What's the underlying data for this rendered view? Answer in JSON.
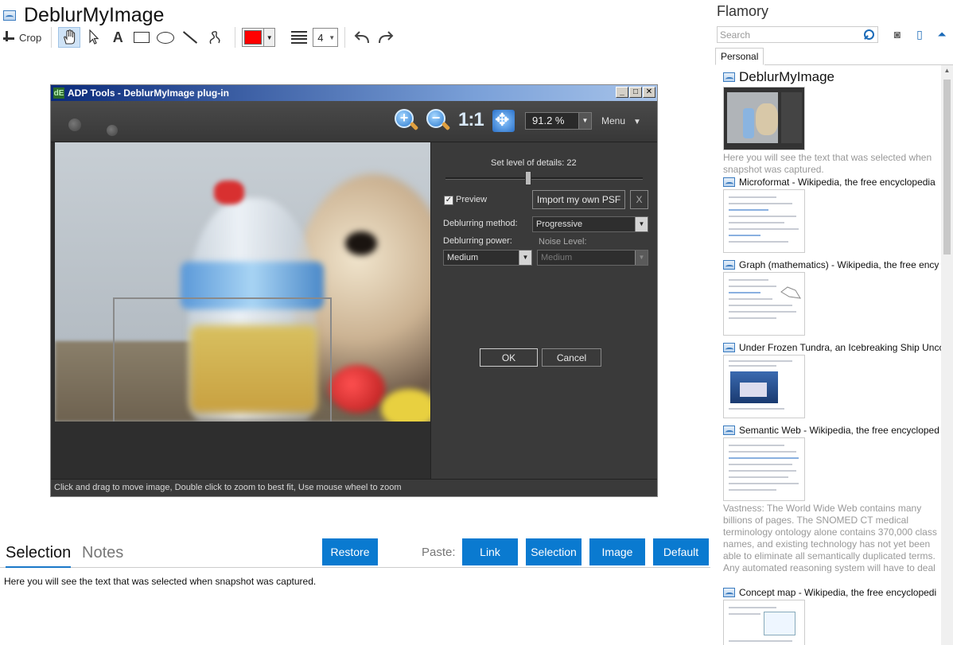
{
  "app": {
    "title": "DeblurMyImage"
  },
  "toolbar": {
    "crop_label": "Crop",
    "text_tool": "A",
    "line_width": "4",
    "color": "#ff0000",
    "tools": [
      "hand-icon",
      "arrow-icon",
      "text-icon",
      "rectangle-icon",
      "ellipse-icon",
      "line-icon",
      "freehand-icon",
      "undo-icon",
      "redo-icon"
    ]
  },
  "plugin": {
    "title": "ADP Tools - DeblurMyImage plug-in",
    "logo": "dE",
    "zoom_value": "91.2 %",
    "one_to_one": "1:1",
    "menu_label": "Menu",
    "detail_label": "Set level of details:",
    "detail_value": "22",
    "detail_level": 0.42,
    "preview_label": "Preview",
    "preview_checked": "✓",
    "import_label": "Import my own PSF",
    "close_psf": "X",
    "method_label": "Deblurring method:",
    "method_value": "Progressive",
    "power_label": "Deblurring power:",
    "power_value": "Medium",
    "noise_label": "Noise Level:",
    "noise_value": "Medium",
    "ok_label": "OK",
    "cancel_label": "Cancel",
    "status": "Click and drag to move image, Double click to zoom to best fit, Use mouse wheel to zoom"
  },
  "bottom": {
    "tab_selection": "Selection",
    "tab_notes": "Notes",
    "restore": "Restore",
    "paste_label": "Paste:",
    "paste_link": "Link",
    "paste_selection": "Selection",
    "paste_image": "Image",
    "paste_default": "Default",
    "selection_text": "Here you will see the text that was selected when snapshot was captured."
  },
  "flamory": {
    "title": "Flamory",
    "search_placeholder": "Search",
    "tab_personal": "Personal",
    "items": [
      {
        "title": "DeblurMyImage",
        "desc": "Here you will see the text that was selected when snapshot was captured."
      },
      {
        "title": "Microformat - Wikipedia, the free encyclopedia",
        "desc": ""
      },
      {
        "title": "Graph (mathematics) - Wikipedia, the free ency",
        "desc": ""
      },
      {
        "title": "Under Frozen Tundra, an Icebreaking Ship Unco",
        "desc": ""
      },
      {
        "title": "Semantic Web - Wikipedia, the free encycloped",
        "desc": "Vastness: The World Wide Web contains many billions of pages. The SNOMED CT medical terminology ontology alone contains 370,000 class names, and existing technology has not yet been able to eliminate all semantically duplicated terms. Any automated reasoning system will have to deal with truly huge inputs."
      },
      {
        "title": "Concept map - Wikipedia, the free encyclopedi",
        "desc": ""
      }
    ]
  }
}
